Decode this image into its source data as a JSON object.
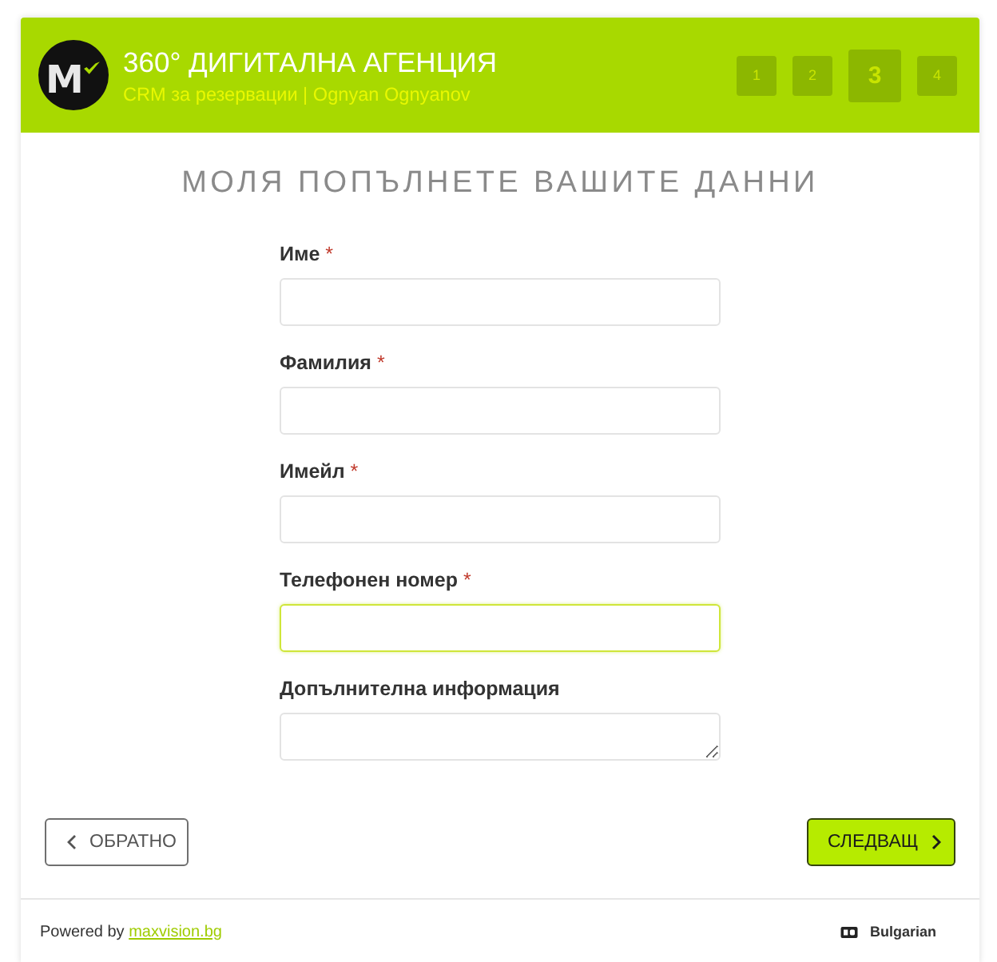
{
  "header": {
    "logo_letter": "M",
    "title": "360° ДИГИТАЛНА АГЕНЦИЯ",
    "subtitle": "CRM за резервации | Ognyan Ognyanov",
    "steps": [
      {
        "label": "1",
        "selected": false
      },
      {
        "label": "2",
        "selected": false
      },
      {
        "label": "3",
        "selected": true
      },
      {
        "label": "4",
        "selected": false
      }
    ]
  },
  "form": {
    "heading": "МОЛЯ ПОПЪЛНЕТЕ ВАШИТЕ ДАННИ",
    "fields": [
      {
        "kind": "input",
        "label": "Име",
        "required_mark": "*",
        "focused": false
      },
      {
        "kind": "input",
        "label": "Фамилия",
        "required_mark": "*",
        "focused": false
      },
      {
        "kind": "input",
        "label": "Имейл",
        "required_mark": "*",
        "focused": false
      },
      {
        "kind": "input",
        "label": "Телефонен номер",
        "required_mark": "*",
        "focused": true
      },
      {
        "kind": "textarea",
        "label": "Допълнителна информация",
        "focused": false
      }
    ]
  },
  "buttons": {
    "back": "ОБРАТНО",
    "next": "СЛЕДВАЩ"
  },
  "footer": {
    "powered_by": "Powered by",
    "link": "maxvision.bg",
    "language": "Bulgarian"
  }
}
